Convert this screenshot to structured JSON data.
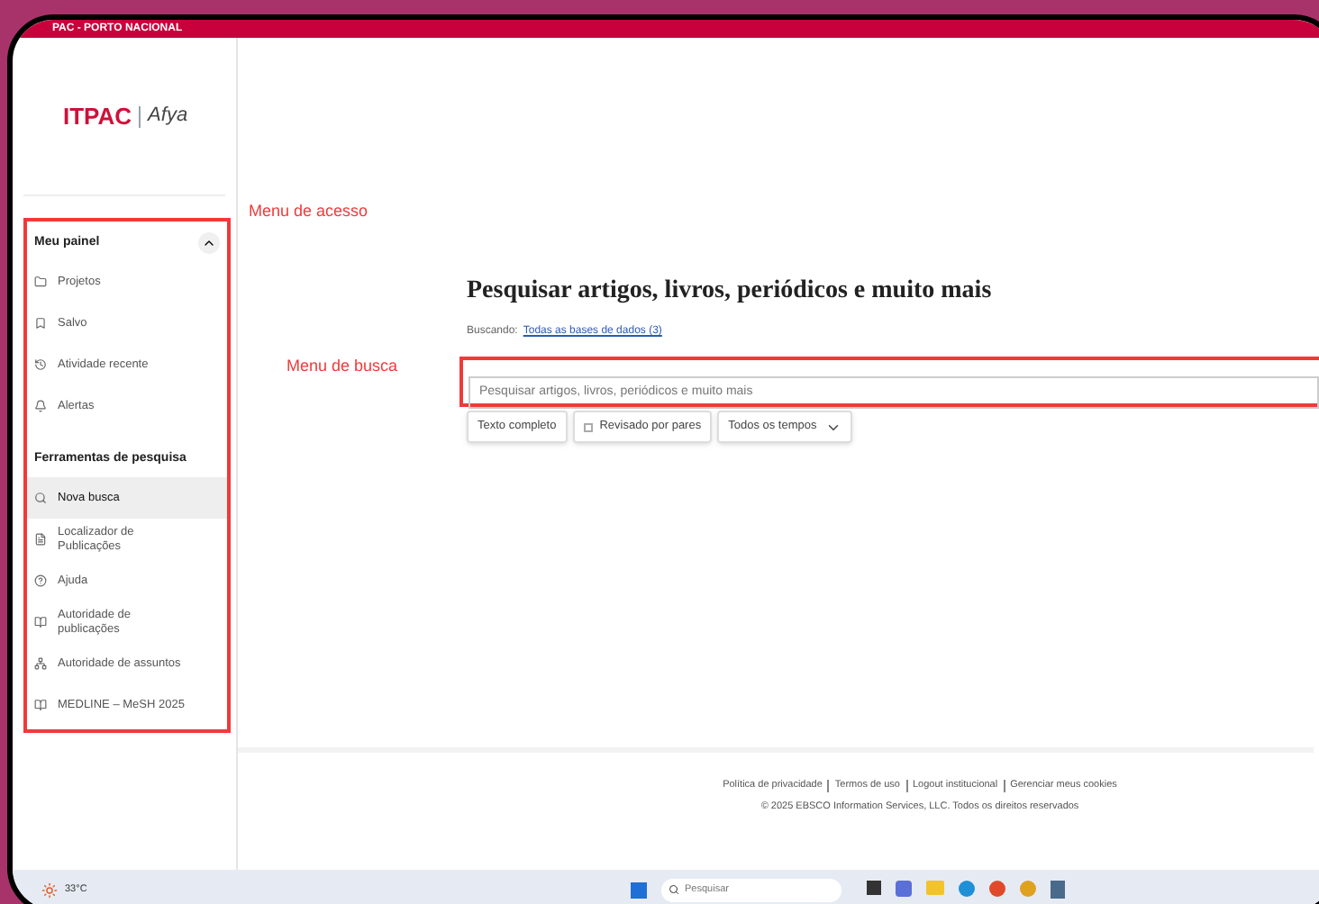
{
  "header": {
    "title": "PAC - PORTO NACIONAL"
  },
  "logo": {
    "brand": "ITPAC",
    "partner": "Afya"
  },
  "sidebar": {
    "sections": [
      {
        "title": "Meu painel",
        "expanded": true,
        "items": [
          {
            "label": "Projetos",
            "selected": false
          },
          {
            "label": "Salvo",
            "selected": false
          },
          {
            "label": "Atividade recente",
            "selected": false
          },
          {
            "label": "Alertas",
            "selected": false
          }
        ]
      },
      {
        "title": "Ferramentas de pesquisa",
        "items": [
          {
            "label": "Nova busca",
            "selected": true
          },
          {
            "label": "Localizador de Publicações",
            "selected": false
          },
          {
            "label": "Ajuda",
            "selected": false
          },
          {
            "label": "Autoridade de publicações",
            "selected": false
          },
          {
            "label": "Autoridade de assuntos",
            "selected": false
          },
          {
            "label": "MEDLINE – MeSH 2025",
            "selected": false
          }
        ]
      }
    ]
  },
  "annotations": [
    "Menu de acesso",
    "Menu de busca"
  ],
  "search": {
    "heading": "Pesquisar artigos, livros, periódicos e muito mais",
    "scope_label": "Buscando:",
    "scope_link": "Todas as bases de dados (3)",
    "placeholder": "Pesquisar artigos, livros, periódicos e muito mais",
    "filters": [
      {
        "kind": "toggle",
        "label": "Texto completo"
      },
      {
        "kind": "checkbox",
        "label": "Revisado por pares",
        "checked": false
      },
      {
        "kind": "dropdown",
        "label": "Todos os tempos"
      }
    ]
  },
  "footer": {
    "links": [
      "Política de privacidade",
      "Termos de uso",
      "Logout institucional",
      "Gerenciar meus cookies"
    ],
    "copyright": "© 2025 EBSCO Information Services, LLC. Todos os direitos reservados"
  },
  "taskbar": {
    "weather": "33°C",
    "search_placeholder": "Pesquisar"
  }
}
